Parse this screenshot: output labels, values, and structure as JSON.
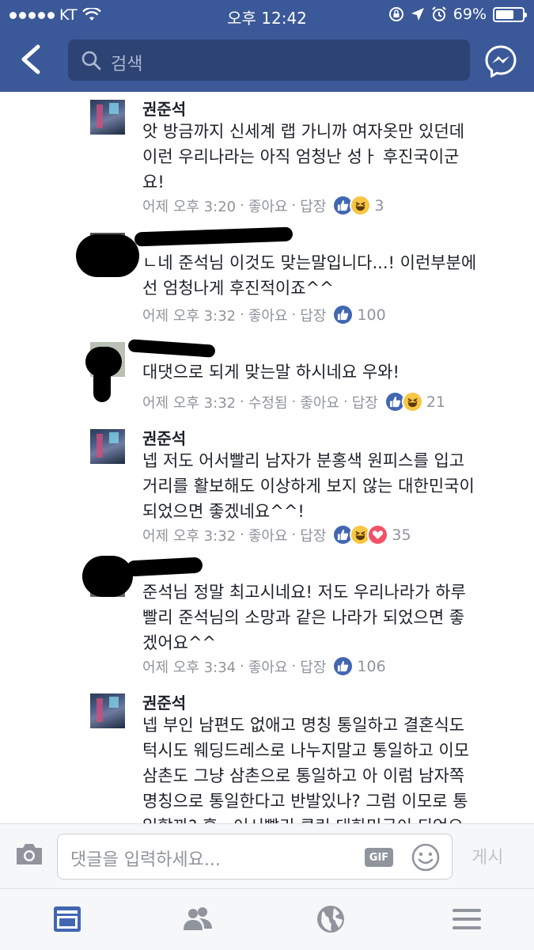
{
  "status_bar": {
    "carrier": "KT",
    "time": "오후 12:42",
    "battery": "69%",
    "battery_level": 0.69
  },
  "header": {
    "search_placeholder": "검색"
  },
  "comments": [
    {
      "author": "권준석",
      "text": "앗 방금까지 신세계 랩 가니까 여자옷만 있던데\n이런 우리나라는 아직 엄청난 성ㅏ 후진국이군\n요!",
      "time": "어제 오후 3:20",
      "edited": "",
      "like_label": "좋아요",
      "reply_label": "답장",
      "reactions": [
        "like",
        "haha"
      ],
      "reaction_count": "3"
    },
    {
      "author": "",
      "text": "ㄴ네 준석님 이것도 맞는말입니다...! 이런부분에\n선 엄청나게 후진적이죠^^",
      "time": "어제 오후 3:32",
      "edited": "",
      "like_label": "좋아요",
      "reply_label": "답장",
      "reactions": [
        "like"
      ],
      "reaction_count": "100"
    },
    {
      "author": "",
      "text": "대댓으로 되게 맞는말 하시네요 우와!",
      "time": "어제 오후 3:32",
      "edited": "수정됨",
      "like_label": "좋아요",
      "reply_label": "답장",
      "reactions": [
        "like",
        "haha"
      ],
      "reaction_count": "21"
    },
    {
      "author": "권준석",
      "text": "넵 저도 어서빨리 남자가 분홍색 원피스를 입고\n거리를 활보해도 이상하게 보지 않는 대한민국이\n되었으면 좋겠네요^^!",
      "time": "어제 오후 3:32",
      "edited": "",
      "like_label": "좋아요",
      "reply_label": "답장",
      "reactions": [
        "like",
        "haha",
        "love"
      ],
      "reaction_count": "35"
    },
    {
      "author": "",
      "text": "준석님 정말 최고시네요! 저도 우리나라가 하루\n빨리 준석님의 소망과 같은 나라가 되었으면 좋\n겠어요^^",
      "time": "어제 오후 3:34",
      "edited": "",
      "like_label": "좋아요",
      "reply_label": "답장",
      "reactions": [
        "like"
      ],
      "reaction_count": "106"
    },
    {
      "author": "권준석",
      "text": "넵 부인 남편도 없애고 명칭 통일하고 결혼식도\n턱시도 웨딩드레스로 나누지말고 통일하고 이모\n삼촌도 그냥 삼촌으로 통일하고 아 이럼 남자쪽\n명칭으로 통일한다고 반발있나? 그럼 이모로 통\n일할까? 흠.. 어서빨리 클린 대한민국이 되었으",
      "time": "",
      "edited": "",
      "like_label": "",
      "reply_label": "",
      "reactions": [],
      "reaction_count": ""
    }
  ],
  "composer": {
    "placeholder": "댓글을 입력하세요...",
    "gif_label": "GIF",
    "post_label": "게시"
  },
  "colors": {
    "header_bg": "#3b5998",
    "like_blue": "#4267b2",
    "haha_yellow": "#f7c644",
    "love_red": "#f25268",
    "meta_gray": "#90949c"
  },
  "icons": [
    "back-arrow-icon",
    "search-icon",
    "messenger-icon",
    "camera-icon",
    "smiley-icon",
    "news-feed-icon",
    "friends-icon",
    "globe-icon",
    "menu-icon"
  ]
}
